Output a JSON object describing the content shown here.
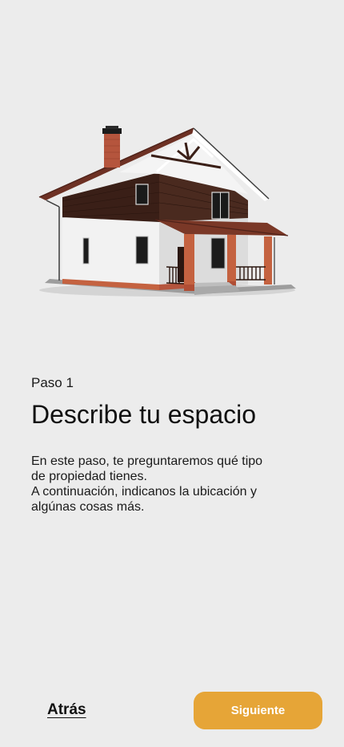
{
  "step": {
    "label": "Paso 1",
    "title": "Describe tu espacio",
    "description_lines": [
      "En este paso, te preguntaremos qué tipo",
      "de propiedad tienes.",
      "A continuación, indicanos la ubicación y",
      "algúnas cosas más."
    ]
  },
  "footer": {
    "back_label": "Atrás",
    "next_label": "Siguiente"
  },
  "colors": {
    "background": "#ececec",
    "accent": "#e6a537"
  },
  "illustration": {
    "icon": "house-illustration"
  }
}
